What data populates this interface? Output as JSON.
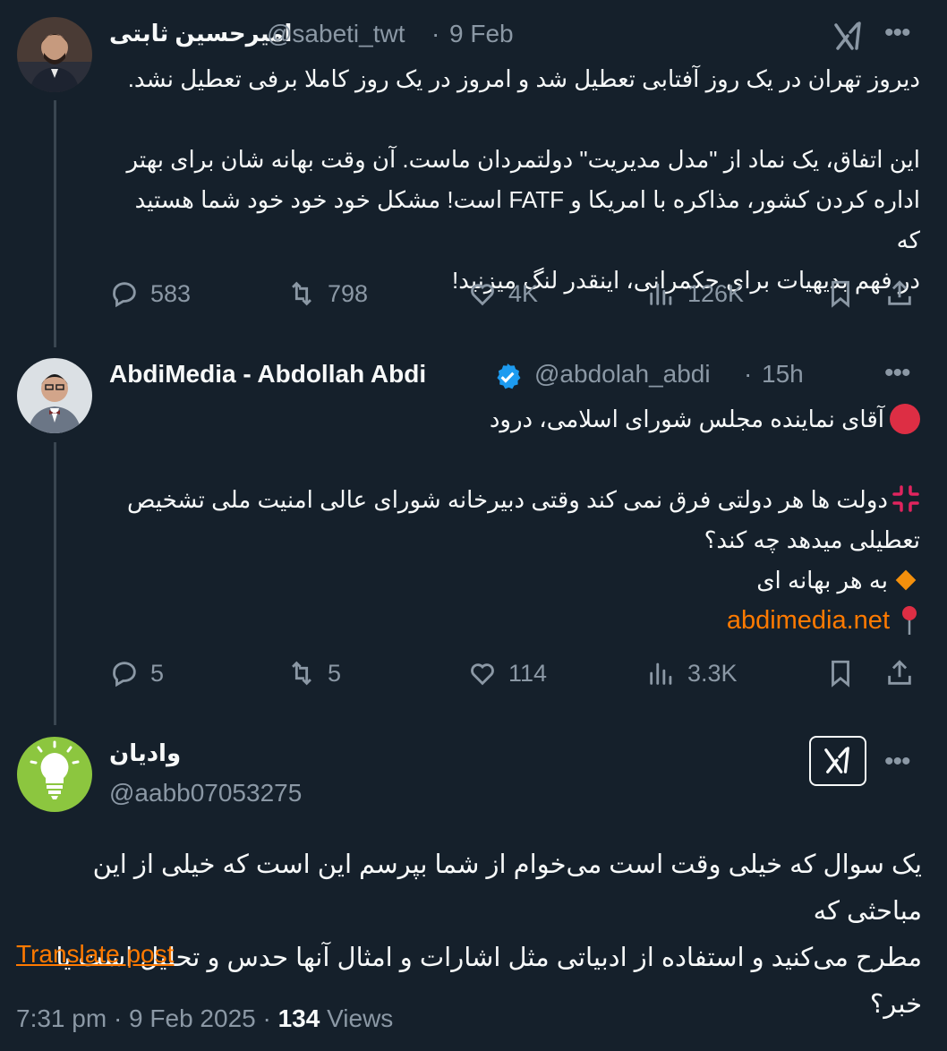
{
  "tweet1": {
    "name": "امیرحسین ثابتی",
    "handle": "@sabeti_twt",
    "sep": "·",
    "date": "9 Feb",
    "lines": [
      "دیروز تهران در یک روز آفتابی تعطیل شد و امروز در یک روز کاملا برفی تعطیل نشد.",
      "",
      "این اتفاق، یک نماد از \"مدل مدیریت\" دولتمردان ماست. آن وقت بهانه شان برای بهتر",
      "اداره کردن کشور، مذاکره با امریکا و FATF است! مشکل خود خود خود شما هستید که",
      "در فهم بدیهیات برای حکمرانی، اینقدر لنگ میزنید!"
    ],
    "replies": "583",
    "reposts": "798",
    "likes": "4K",
    "views": "126K"
  },
  "tweet2": {
    "name": "AbdiMedia - Abdollah Abdi",
    "handle": "@abdolah_abdi",
    "sep": "·",
    "time": "15h",
    "line1": "آقای نماینده مجلس شورای اسلامی، درود",
    "line2": "دولت ها هر دولتی فرق نمی کند وقتی دبیرخانه شورای عالی امنیت ملی تشخیص",
    "line3": "تعطیلی میدهد چه کند؟",
    "line4": "به هر بهانه ای",
    "link": "abdimedia.net",
    "replies": "5",
    "reposts": "5",
    "likes": "114",
    "views": "3.3K"
  },
  "tweet3": {
    "name": "وادیان",
    "handle": "@aabb07053275",
    "line1": "یک سوال که خیلی وقت است می‌خوام از شما بپرسم این است که خیلی از این مباحثی که",
    "line2": "مطرح می‌کنید و استفاده از ادبیاتی مثل اشارات و امثال آنها حدس و تحلیل است یا خبر؟",
    "translate": "Translate post",
    "timestamp": "7:31 pm · 9 Feb 2025 · ",
    "views_count": "134",
    "views_label": " Views"
  },
  "icons": {
    "more": "more-icon",
    "grok": "grok-icon",
    "reply": "reply-icon",
    "repost": "repost-icon",
    "like": "like-icon",
    "views": "views-icon",
    "bookmark": "bookmark-icon",
    "share": "share-icon",
    "verified": "verified-badge-icon"
  },
  "colors": {
    "background": "#15202b",
    "text": "#f7f9f9",
    "muted": "#8b98a5",
    "accent": "#ff7a00",
    "verified": "#1d9bf0"
  }
}
